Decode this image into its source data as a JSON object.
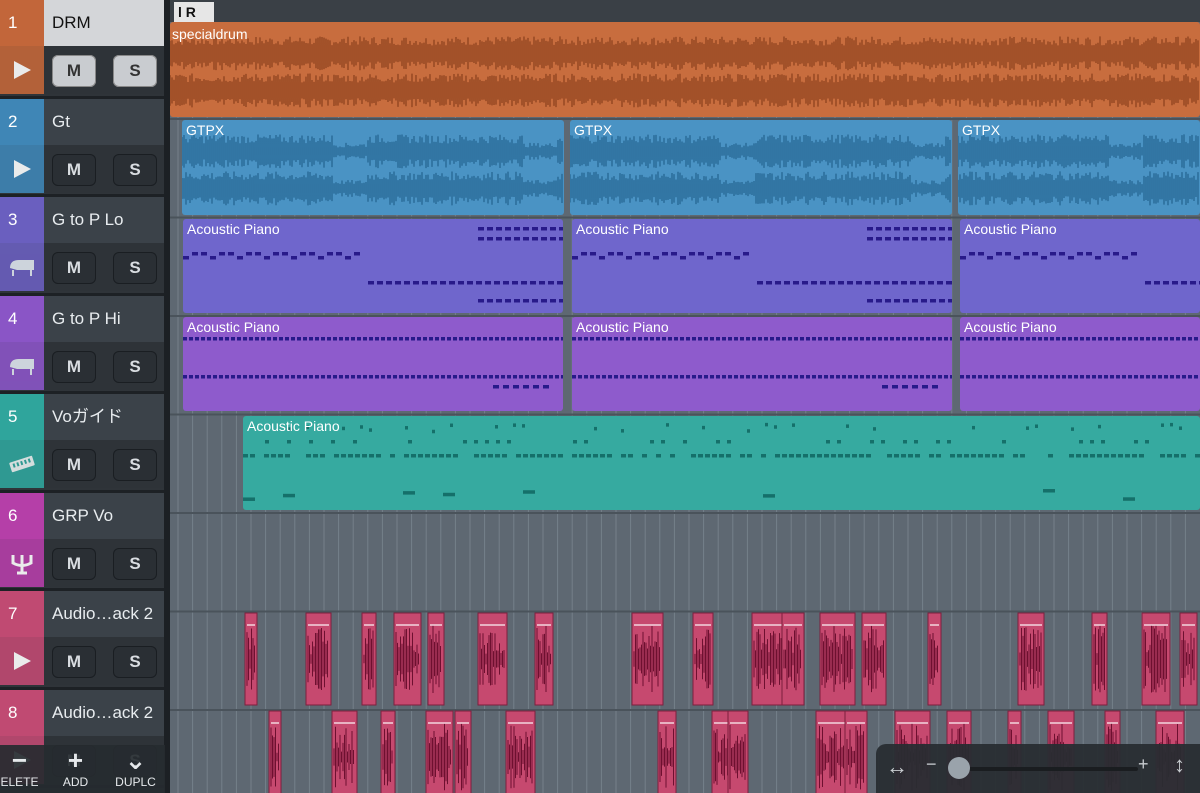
{
  "ruler": {
    "locators": "l R"
  },
  "tracks": [
    {
      "num": "1",
      "name": "DRM",
      "icon": "audio-play-icon",
      "color": "#c2663a",
      "selected": true
    },
    {
      "num": "2",
      "name": "Gt",
      "icon": "audio-play-icon",
      "color": "#3f86b6"
    },
    {
      "num": "3",
      "name": "G to P Lo",
      "icon": "piano-icon",
      "color": "#6a5fbf"
    },
    {
      "num": "4",
      "name": "G to P Hi",
      "icon": "piano-icon",
      "color": "#8a55c6"
    },
    {
      "num": "5",
      "name": "Voガイド",
      "icon": "keyboard-icon",
      "color": "#2fa59c"
    },
    {
      "num": "6",
      "name": "GRP Vo",
      "icon": "folder-group-icon",
      "color": "#b53fa8"
    },
    {
      "num": "7",
      "name": "Audio…ack 2",
      "icon": "audio-play-icon",
      "color": "#c04a72"
    },
    {
      "num": "8",
      "name": "Audio…ack 2",
      "icon": "audio-play-icon",
      "color": "#c04a72"
    }
  ],
  "buttons": {
    "mute": "M",
    "solo": "S"
  },
  "regions": {
    "drm": "specialdrum",
    "gt": [
      "GTPX",
      "GTPX",
      "GTPX"
    ],
    "lo": [
      "Acoustic Piano",
      "Acoustic Piano",
      "Acoustic Piano"
    ],
    "hi": [
      "Acoustic Piano",
      "Acoustic Piano",
      "Acoustic Piano"
    ],
    "vo": "Acoustic Piano"
  },
  "toolbar": {
    "delete_label": "ELETE",
    "delete_glyph": "−",
    "add_label": "ADD",
    "add_glyph": "+",
    "dup_label": "DUPLC",
    "dup_glyph": "⌄"
  },
  "zoom": {
    "h_glyph": "↔",
    "minus": "−",
    "plus": "+",
    "v_glyph": "↕",
    "level": 0.0
  }
}
